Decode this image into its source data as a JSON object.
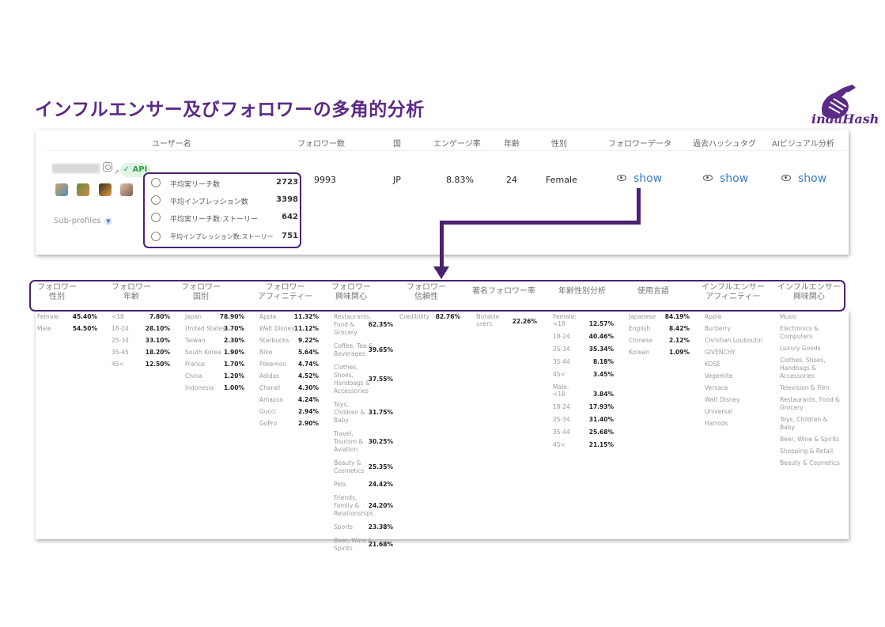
{
  "title": "インフルエンサー及びフォロワーの多角的分析",
  "logo_text": "indaHash",
  "colors": {
    "accent": "#4b2272",
    "link": "#3c7ec6",
    "api_green": "#2e9e4b"
  },
  "table_headers": {
    "username": "ユーザー名",
    "followers": "フォロワー数",
    "country": "国",
    "engagement": "エンゲージ率",
    "age": "年齢",
    "gender": "性別",
    "follower_data": "フォロワーデータ",
    "past_hashtags": "過去ハッシュタグ",
    "ai_visual": "AIビジュアル分析"
  },
  "influencer": {
    "api_badge": "API",
    "sub_profiles": "Sub-profiles",
    "followers": "9993",
    "country": "JP",
    "engagement": "8.83%",
    "age": "24",
    "gender": "Female",
    "show_label": "show"
  },
  "reach_stats": [
    {
      "label": "平均実リーチ数",
      "value": "2723"
    },
    {
      "label": "平均インプレッション数",
      "value": "3398"
    },
    {
      "label": "平均実リーチ数:ストーリー",
      "value": "642"
    },
    {
      "label": "平均インプレッション数:ストーリー",
      "value": "751"
    }
  ],
  "analysis_headers": [
    "フォロワー\n性別",
    "フォロワー\n年齢",
    "フォロワー\n国別",
    "フォロワー\nアフィニティー",
    "フォロワー\n興味関心",
    "フォロワー\n信頼性",
    "著名フォロワー率",
    "年齢性別分析",
    "使用言語",
    "インフルエンサー\nアフィニティー",
    "インフルエンサー\n興味関心"
  ],
  "gender": [
    {
      "label": "Female",
      "value": "45.40%"
    },
    {
      "label": "Male",
      "value": "54.50%"
    }
  ],
  "age": [
    {
      "label": "<18",
      "value": "7.80%"
    },
    {
      "label": "18-24",
      "value": "28.10%"
    },
    {
      "label": "25-34",
      "value": "33.10%"
    },
    {
      "label": "35-45",
      "value": "18.20%"
    },
    {
      "label": "45<",
      "value": "12.50%"
    }
  ],
  "countries": [
    {
      "label": "Japan",
      "value": "78.90%"
    },
    {
      "label": "United States",
      "value": "3.70%"
    },
    {
      "label": "Taiwan",
      "value": "2.30%"
    },
    {
      "label": "South Korea",
      "value": "1.90%"
    },
    {
      "label": "France",
      "value": "1.70%"
    },
    {
      "label": "China",
      "value": "1.20%"
    },
    {
      "label": "Indonesia",
      "value": "1.00%"
    }
  ],
  "follower_affinity": [
    {
      "label": "Apple",
      "value": "11.32%"
    },
    {
      "label": "Walt Disney",
      "value": "11.12%"
    },
    {
      "label": "Starbucks",
      "value": "9.22%"
    },
    {
      "label": "Nike",
      "value": "5.64%"
    },
    {
      "label": "Pokemon",
      "value": "4.74%"
    },
    {
      "label": "Adidas",
      "value": "4.52%"
    },
    {
      "label": "Chanel",
      "value": "4.30%"
    },
    {
      "label": "Amazon",
      "value": "4.24%"
    },
    {
      "label": "Gucci",
      "value": "2.94%"
    },
    {
      "label": "GoPro",
      "value": "2.90%"
    }
  ],
  "follower_interests": [
    {
      "label": "Restaurants,\nFood &\nGrocery",
      "value": "62.35%"
    },
    {
      "label": "Coffee, Tea &\nBeverages",
      "value": "39.65%"
    },
    {
      "label": "Clothes,\nShoes,\nHandbags &\nAccessories",
      "value": "37.55%"
    },
    {
      "label": "Toys,\nChildren &\nBaby",
      "value": "31.75%"
    },
    {
      "label": "Travel,\nTourism &\nAviation",
      "value": "30.25%"
    },
    {
      "label": "Beauty &\nCosmetics",
      "value": "25.35%"
    },
    {
      "label": "Pets",
      "value": "24.42%"
    },
    {
      "label": "Friends,\nFamily &\nRelationships",
      "value": "24.20%"
    },
    {
      "label": "Sports",
      "value": "23.38%"
    },
    {
      "label": "Beer, Wine &\nSpirits",
      "value": "21.68%"
    }
  ],
  "credibility": {
    "label": "Credibility",
    "value": "82.76%"
  },
  "notable": {
    "label": "Notable\nusers",
    "value": "22.26%"
  },
  "age_gender": {
    "female_label": "Female:",
    "female": [
      {
        "label": "<18",
        "value": "12.57%"
      },
      {
        "label": "18-24",
        "value": "40.46%"
      },
      {
        "label": "25-34",
        "value": "35.34%"
      },
      {
        "label": "35-44",
        "value": "8.18%"
      },
      {
        "label": "45<",
        "value": "3.45%"
      }
    ],
    "male_label": "Male:",
    "male": [
      {
        "label": "<18",
        "value": "3.84%"
      },
      {
        "label": "18-24",
        "value": "17.93%"
      },
      {
        "label": "25-34",
        "value": "31.40%"
      },
      {
        "label": "35-44",
        "value": "25.68%"
      },
      {
        "label": "45<",
        "value": "21.15%"
      }
    ]
  },
  "languages": [
    {
      "label": "Japanese",
      "value": "84.19%"
    },
    {
      "label": "English",
      "value": "8.42%"
    },
    {
      "label": "Chinese",
      "value": "2.12%"
    },
    {
      "label": "Korean",
      "value": "1.09%"
    }
  ],
  "influencer_affinity": [
    "Apple",
    "Burberry",
    "Christian Louboutin",
    "GIVENCHY",
    "KOSÉ",
    "Vegemite",
    "Versace",
    "Walt Disney",
    "Universal",
    "Harrods"
  ],
  "influencer_interests": [
    "Music",
    "Electronics &\nComputers",
    "Luxury Goods",
    "Clothes, Shoes,\nHandbags &\nAccessories",
    "Television & Film",
    "Restaurants, Food &\nGrocery",
    "Toys, Children &\nBaby",
    "Beer, Wine & Spirits",
    "Shopping & Retail",
    "Beauty & Cosmetics"
  ]
}
